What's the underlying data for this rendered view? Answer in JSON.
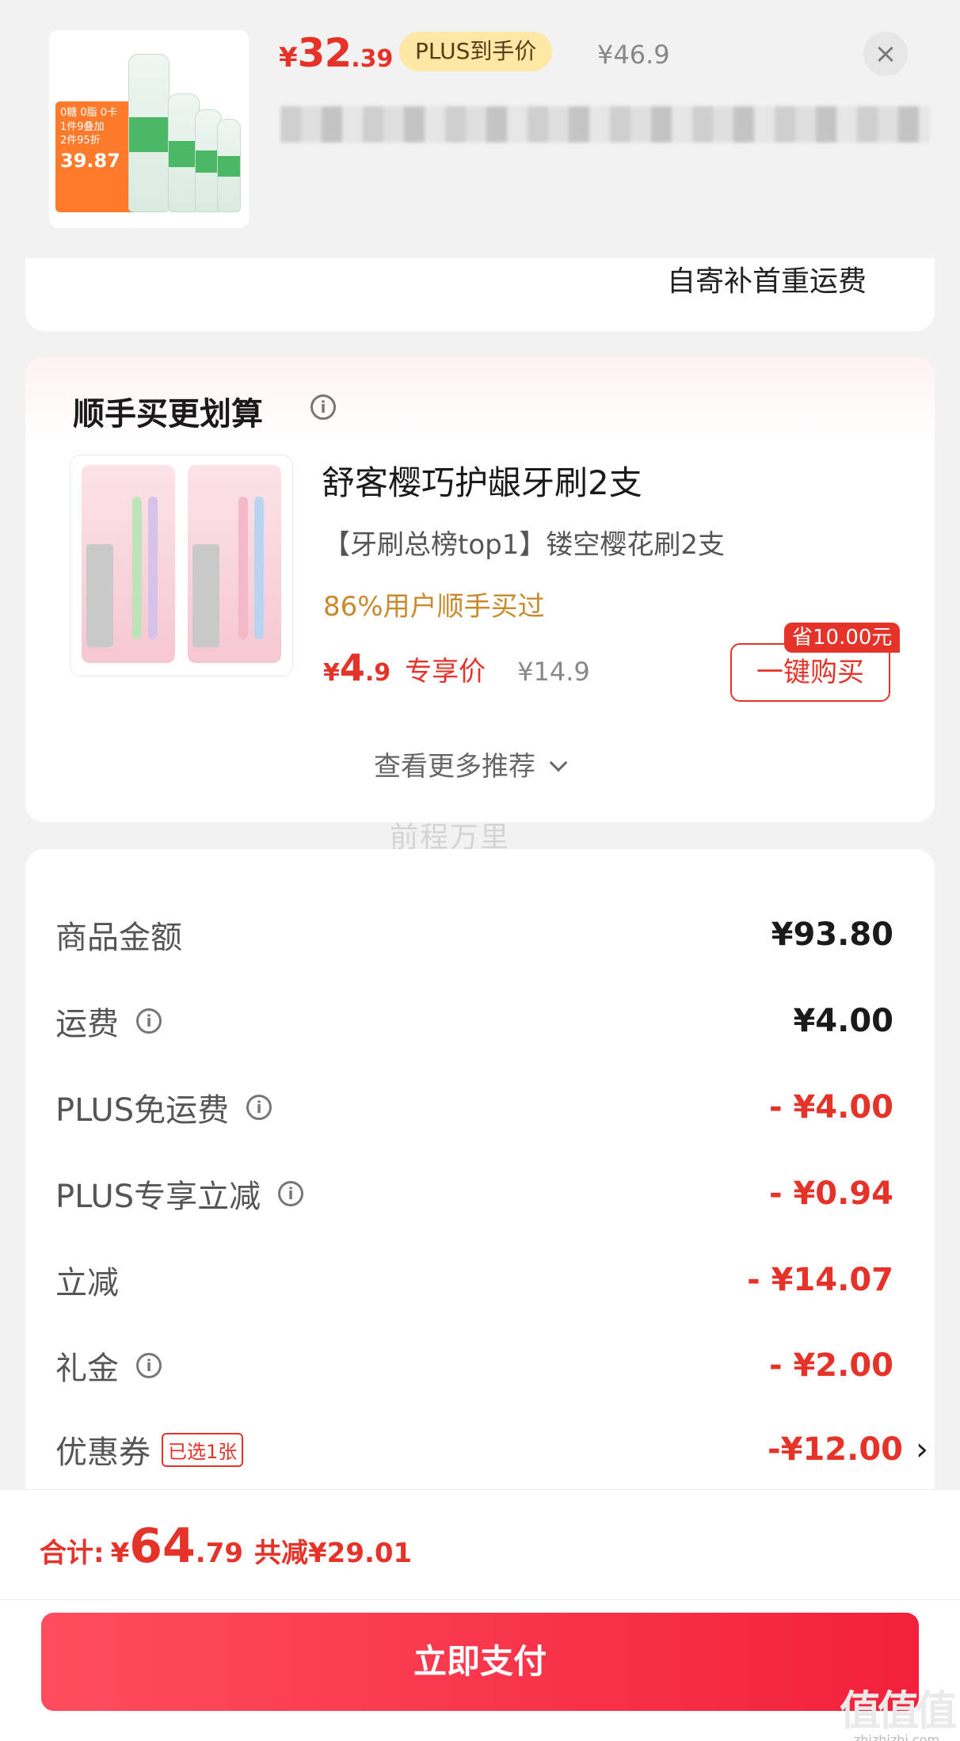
{
  "header": {
    "price_currency": "¥",
    "price_int": "32",
    "price_dec": ".39",
    "plus_tag": "PLUS到手价",
    "original_price": "¥46.9",
    "close_icon": "×",
    "thumb_promo": {
      "line1": "0糖 0脂 0卡",
      "line2": "1件9叠加",
      "line3": "2件95折",
      "price": "39.87"
    }
  },
  "shipping_card": {
    "text": "自寄补首重运费"
  },
  "recommend": {
    "title": "顺手买更划算",
    "product_name": "舒客樱巧护龈牙刷2支",
    "product_sub": "【牙刷总榜top1】镂空樱花刷2支",
    "buyers": "86%用户顺手买过",
    "price_currency": "¥",
    "price_int": "4",
    "price_dec": ".9",
    "exclusive_label": "专享价",
    "original_price": "¥14.9",
    "save_tag": "省10.00元",
    "buy_button": "一键购买",
    "more_link": "查看更多推荐",
    "more_icon": "chevron-down-icon"
  },
  "watermark": "前程万里",
  "summary": {
    "rows": [
      {
        "label": "商品金额",
        "value": "¥93.80",
        "info": false,
        "red": false
      },
      {
        "label": "运费",
        "value": "¥4.00",
        "info": true,
        "red": false
      },
      {
        "label": "PLUS免运费",
        "value": "- ¥4.00",
        "info": true,
        "red": true
      },
      {
        "label": "PLUS专享立减",
        "value": "- ¥0.94",
        "info": true,
        "red": true
      },
      {
        "label": "立减",
        "value": "- ¥14.07",
        "info": false,
        "red": true
      },
      {
        "label": "礼金",
        "value": "- ¥2.00",
        "info": true,
        "red": true
      },
      {
        "label": "优惠券",
        "value": "-¥12.00",
        "info": false,
        "red": true,
        "badge": "已选1张",
        "chevron": "›"
      }
    ]
  },
  "bottom": {
    "total_label": "合计:",
    "total_currency": "¥",
    "total_int": "64",
    "total_dec": ".79",
    "total_saved": "共减¥29.01",
    "pay_button": "立即支付"
  },
  "brand": {
    "logo": "值值值",
    "url": "zhizhizhi.com"
  },
  "colors": {
    "accent": "#e6332a",
    "plus_tag_bg": "#ffe8a6",
    "buyers_text": "#c88a2c"
  }
}
